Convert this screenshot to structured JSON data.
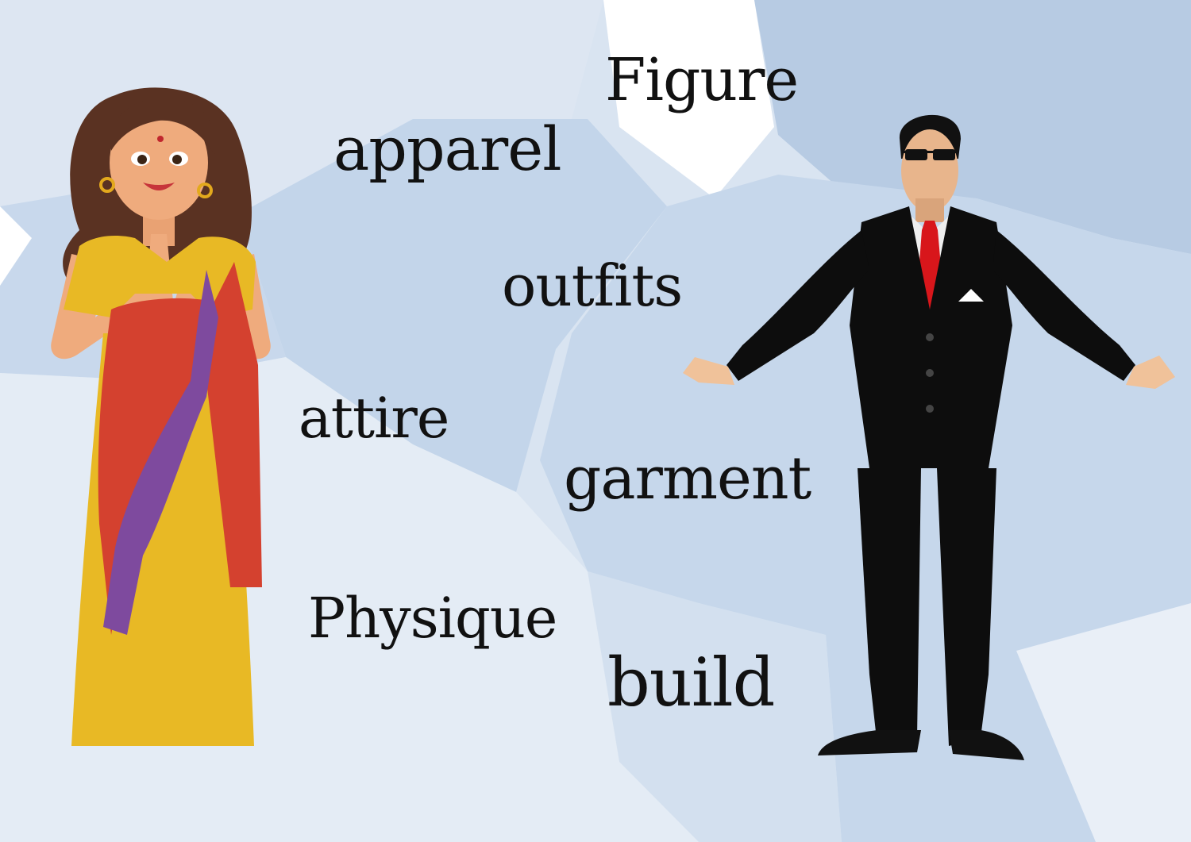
{
  "words": {
    "figure": "Figure",
    "apparel": "apparel",
    "outfits": "outfits",
    "attire": "attire",
    "garment": "garment",
    "physique": "Physique",
    "build": "build"
  },
  "colors": {
    "background_wash": "#c9d8ea",
    "background_light": "#dfe8f3",
    "text": "#111111",
    "saree_yellow": "#e8b925",
    "saree_red": "#d4412f",
    "saree_purple": "#7e4a9e",
    "suit": "#0d0d0d",
    "tie": "#d8161b"
  },
  "illustrations": {
    "left": "woman-in-saree-namaste",
    "right": "man-in-black-suit-sunglasses"
  }
}
